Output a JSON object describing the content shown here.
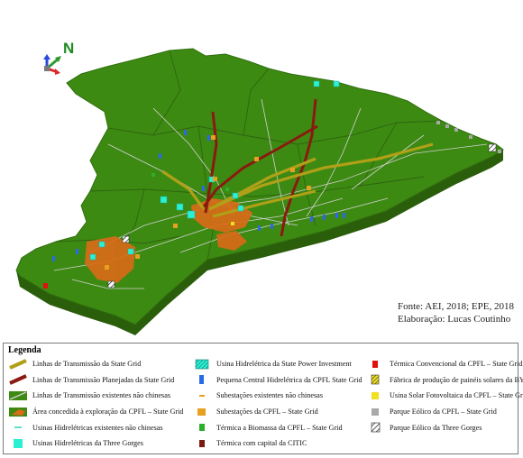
{
  "map": {
    "north_label": "N",
    "source_line": "Fonte: AEI, 2018; EPE, 2018",
    "author_line": "Elaboração: Lucas Coutinho",
    "colors": {
      "land_top": "#3d8a12",
      "land_side": "#2a5e0b",
      "transmission_state_grid": "#b0a018",
      "transmission_planned": "#8a1a10",
      "transmission_non_chinese": "#c9c9c9",
      "cpfl_area": "#d86a18",
      "three_gorges_hydro": "#2bf0d4",
      "cpfl_small_hydro": "#2a6ae8",
      "cpfl_substation": "#e8a020"
    }
  },
  "legend": {
    "title": "Legenda",
    "columns": [
      {
        "items": [
          {
            "icon": "transmission-line-state-grid-icon",
            "label": "Linhas de Transmissão da State Grid"
          },
          {
            "icon": "planned-transmission-line-icon",
            "label": "Linhas de Transmissão Planejadas da State Grid"
          },
          {
            "icon": "non-chinese-transmission-line-icon",
            "label": "Linhas de Transmissão existentes não chinesas"
          },
          {
            "icon": "cpfl-concession-area-icon",
            "label": "Área concedida à exploração da CPFL – State Grid"
          },
          {
            "icon": "non-chinese-hydro-icon",
            "label": "Usinas Hidrelétricas existentes não chinesas"
          },
          {
            "icon": "three-gorges-hydro-icon",
            "label": "Usinas Hidrelétricas da Three Gorges"
          }
        ]
      },
      {
        "items": [
          {
            "icon": "spi-hydro-icon",
            "label": "Usina Hidrelétrica da State Power Investment"
          },
          {
            "icon": "cpfl-small-hydro-icon",
            "label": "Pequena Central Hidrelétrica da CPFL State Grid"
          },
          {
            "icon": "non-chinese-substation-icon",
            "label": "Subestações existentes não chinesas"
          },
          {
            "icon": "cpfl-substation-icon",
            "label": "Subestações da CPFL – State Grid"
          },
          {
            "icon": "biomass-thermal-icon",
            "label": "Térmica a Biomassa da CPFL – State Grid"
          },
          {
            "icon": "citic-thermal-icon",
            "label": "Térmica com capital da CITIC"
          }
        ]
      },
      {
        "items": [
          {
            "icon": "conventional-thermal-icon",
            "label": "Térmica Convencional da CPFL – State Grid"
          },
          {
            "icon": "byd-factory-icon",
            "label": "Fábrica de produção de painéis solares da BYD"
          },
          {
            "icon": "solar-plant-icon",
            "label": "Usina Solar Fotovoltaica da CPFL – State Grid"
          },
          {
            "icon": "cpfl-wind-park-icon",
            "label": "Parque Eólico da  CPFL – State Grid"
          },
          {
            "icon": "three-gorges-wind-icon",
            "label": "Parque Eólico da Three Gorges"
          }
        ]
      }
    ]
  }
}
